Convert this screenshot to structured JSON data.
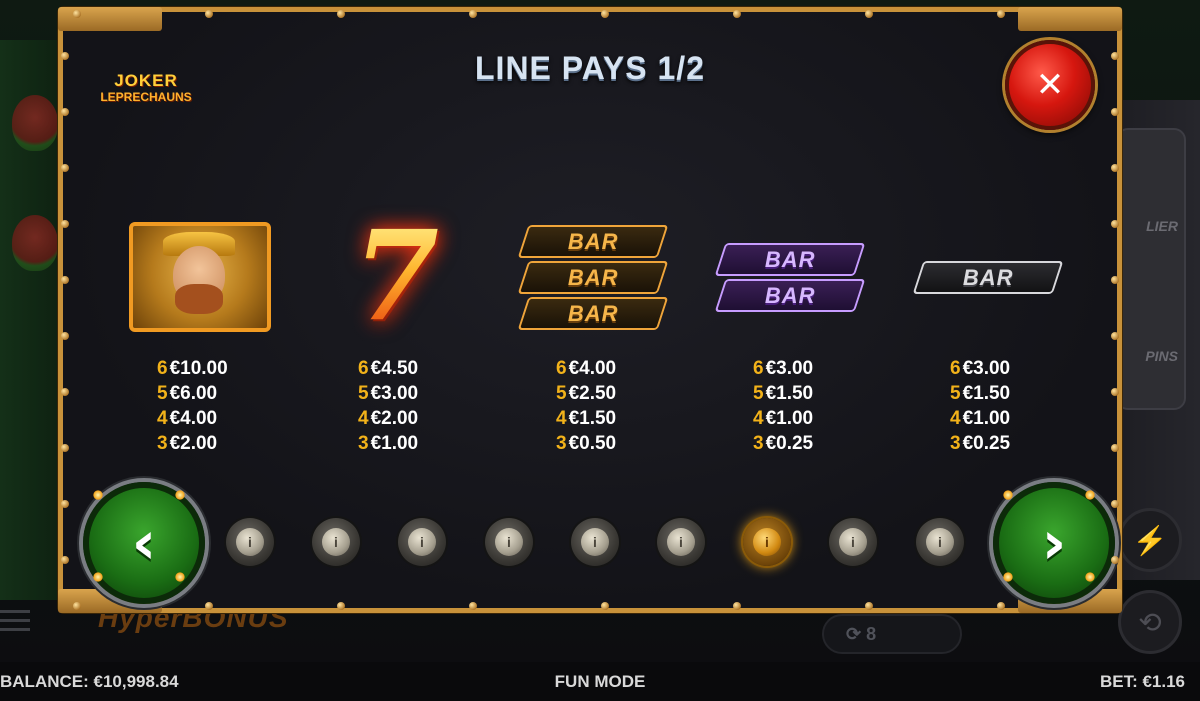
{
  "modal": {
    "title": "LINE PAYS 1/2",
    "logo": {
      "line1": "JOKER",
      "line2": "LEPRECHAUNS"
    },
    "close_label": "✕",
    "prev_label": "‹",
    "next_label": "›"
  },
  "symbols": [
    {
      "name": "joker-leprechaun",
      "pays": [
        {
          "count": "6",
          "value": "€10.00"
        },
        {
          "count": "5",
          "value": "€6.00"
        },
        {
          "count": "4",
          "value": "€4.00"
        },
        {
          "count": "3",
          "value": "€2.00"
        }
      ]
    },
    {
      "name": "red-seven",
      "glyph": "7",
      "pays": [
        {
          "count": "6",
          "value": "€4.50"
        },
        {
          "count": "5",
          "value": "€3.00"
        },
        {
          "count": "4",
          "value": "€2.00"
        },
        {
          "count": "3",
          "value": "€1.00"
        }
      ]
    },
    {
      "name": "triple-bar",
      "label": "BAR",
      "pays": [
        {
          "count": "6",
          "value": "€4.00"
        },
        {
          "count": "5",
          "value": "€2.50"
        },
        {
          "count": "4",
          "value": "€1.50"
        },
        {
          "count": "3",
          "value": "€0.50"
        }
      ]
    },
    {
      "name": "double-bar",
      "label": "BAR",
      "pays": [
        {
          "count": "6",
          "value": "€3.00"
        },
        {
          "count": "5",
          "value": "€1.50"
        },
        {
          "count": "4",
          "value": "€1.00"
        },
        {
          "count": "3",
          "value": "€0.25"
        }
      ]
    },
    {
      "name": "single-bar",
      "label": "BAR",
      "pays": [
        {
          "count": "6",
          "value": "€3.00"
        },
        {
          "count": "5",
          "value": "€1.50"
        },
        {
          "count": "4",
          "value": "€1.00"
        },
        {
          "count": "3",
          "value": "€0.25"
        }
      ]
    }
  ],
  "pagination": {
    "page_count": 9,
    "active_index": 6,
    "dot_glyph": "i"
  },
  "background": {
    "hyper_label_a": "Hyper",
    "hyper_label_b": "BONUS",
    "autoplay_label": "⟳ 8",
    "right_text_1": "LIER",
    "right_text_2": "PINS"
  },
  "status": {
    "balance": "BALANCE: €10,998.84",
    "mode": "FUN MODE",
    "bet": "BET: €1.16"
  },
  "colors": {
    "frame": "#c8923a",
    "pay_count": "#f2b21a",
    "close": "#d6170f",
    "nav": "#1a6d14"
  }
}
